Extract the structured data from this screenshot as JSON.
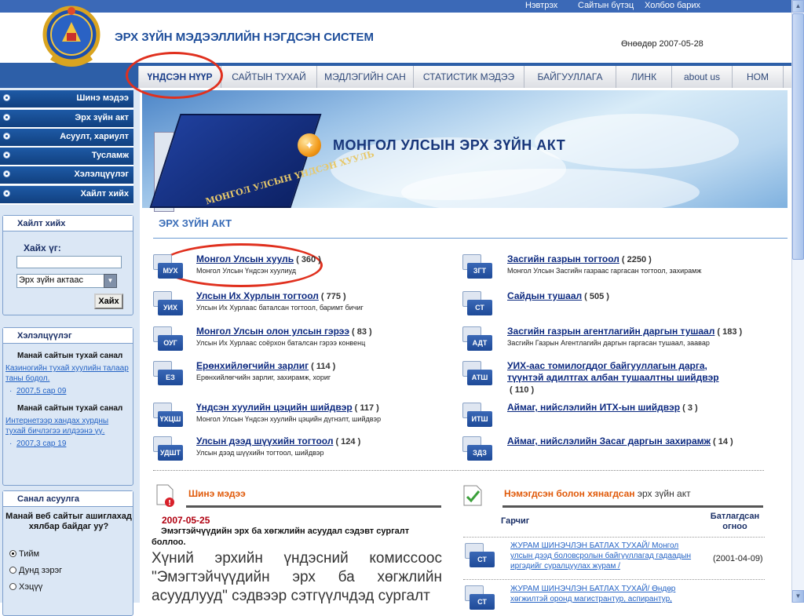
{
  "topbar": {
    "links": [
      "Нэвтрэх",
      "Сайтын бүтэц",
      "Холбоо барих"
    ]
  },
  "header": {
    "title": "ЭРХ ЗҮЙН МЭДЭЭЛЛИЙН НЭГДСЭН СИСТЕМ",
    "date_label": "Өнөөдөр",
    "date_value": "2007-05-28"
  },
  "nav": {
    "items": [
      "ҮНДСЭН НҮҮР",
      "САЙТЫН ТУХАЙ",
      "МЭДЛЭГИЙН САН",
      "СТАТИСТИК МЭДЭЭ",
      "БАЙГУУЛЛАГА",
      "ЛИНК",
      "about us",
      "НОМ"
    ],
    "active": "ҮНДСЭН НҮҮР"
  },
  "sidebar": {
    "menu": [
      "Шинэ мэдээ",
      "Эрх зүйн акт",
      "Асуулт, хариулт",
      "Тусламж",
      "Хэлэлцүүлэг",
      "Хайлт хийх"
    ],
    "search": {
      "title": "Хайлт хийх",
      "label": "Хайх үг:",
      "input_value": "",
      "select_value": "Эрх зүйн актаас",
      "button": "Хайх"
    },
    "discussion": {
      "title": "Хэлэлцүүлэг",
      "entries": [
        {
          "title": "Манай сайтын тухай санал",
          "link": "Казиногийн тухай хуулийн талаар таны бодол.",
          "date": "2007,5 сар 09"
        },
        {
          "title": "Манай сайтын тухай санал",
          "link": "Интернетээр хандах хурдны тухай бичлэгээ илдээнэ үү.",
          "date": "2007,3 сар 19"
        }
      ]
    },
    "poll": {
      "title": "Санал асуулга",
      "question": "Манай веб сайтыг ашиглахад хялбар байдаг уу?",
      "options": [
        "Тийм",
        "Дунд зэрэг",
        "Хэцүү"
      ],
      "selected": "Тийм"
    }
  },
  "banner": {
    "title": "МОНГОЛ УЛСЫН ЭРХ ЗҮЙН АКТ",
    "book_text": "МОНГОЛ УЛСЫН ҮНДСЭН ХУУЛЬ"
  },
  "acts": {
    "section_title": "ЭРХ ЗҮЙН АКТ",
    "left": [
      {
        "code": "МУХ",
        "title": "Монгол Улсын хууль",
        "count": "( 360 )",
        "desc": "Монгол Улсын Үндсэн хуулиуд"
      },
      {
        "code": "УИХ",
        "title": "Улсын Их Хурлын тогтоол",
        "count": "( 775 )",
        "desc": "Улсын Их Хурлаас баталсан тогтоол, баримт бичиг"
      },
      {
        "code": "ОУГ",
        "title": "Монгол Улсын олон улсын гэрээ",
        "count": "( 83 )",
        "desc": "Улсын Их Хурлаас соёрхон баталсан гэрээ конвенц"
      },
      {
        "code": "ЕЗ",
        "title": "Ерөнхийлөгчийн зарлиг",
        "count": "( 114 )",
        "desc": "Ерөнхийлөгчийн зарлиг, захирамж, хориг"
      },
      {
        "code": "ҮХЦШ",
        "title": "Үндсэн хуулийн цэцийн шийдвэр",
        "count": "( 117 )",
        "desc": "Монгол Улсын Үндсэн хуулийн цэцийн дүгнэлт, шийдвэр"
      },
      {
        "code": "УДШТ",
        "title": "Улсын дээд шүүхийн тогтоол",
        "count": "( 124 )",
        "desc": "Улсын дээд шүүхийн тогтоол, шийдвэр"
      }
    ],
    "right": [
      {
        "code": "ЗГТ",
        "title": "Засгийн газрын тогтоол",
        "count": "( 2250 )",
        "desc": "Монгол Улсын Засгийн газраас гаргасан тогтоол, захирамж"
      },
      {
        "code": "СТ",
        "title": "Сайдын тушаал",
        "count": "( 505 )",
        "desc": ""
      },
      {
        "code": "АДТ",
        "title": "Засгийн газрын агентлагийн даргын тушаал",
        "count": "( 183 )",
        "desc": "Засгийн Газрын Агентлагийн даргын гаргасан тушаал, заавар"
      },
      {
        "code": "АТШ",
        "title": "УИХ-аас томилогддог байгууллагын дарга, түүнтэй адилтгах албан тушаалтны шийдвэр",
        "count": "( 110 )",
        "desc": ""
      },
      {
        "code": "ИТШ",
        "title": "Аймаг, нийслэлийн ИТХ-ын шийдвэр",
        "count": "( 3 )",
        "desc": ""
      },
      {
        "code": "ЗДЗ",
        "title": "Аймаг, нийслэлийн Засаг даргын захирамж",
        "count": "( 14 )",
        "desc": ""
      }
    ]
  },
  "news": {
    "title": "Шинэ мэдээ",
    "date": "2007-05-25",
    "headline": "Эмэгтэйчүүдийн эрх ба хөгжлийн асуудал сэдэвт сургалт боллоо.",
    "body": "Хүний эрхийн үндэсний комиссоос \"Эмэгтэйчүүдийн эрх ба хөгжлийн асуудлууд\" сэдвээр сэтгүүлчдэд сургалт"
  },
  "updates": {
    "title_orange": "Нэмэгдсэн болон хянагдсан",
    "title_plain": "эрх зүйн акт",
    "col_title": "Гарчиг",
    "col_date": "Батлагдсан огноо",
    "rows": [
      {
        "code": "СТ",
        "text": "ЖУРАМ ШИНЭЧЛЭН БАТЛАХ ТУХАЙ/ Монгол улсын дээд боловсролын байгууллагад гадаадын иргэдийг суралцуулах журам /",
        "date": "(2001-04-09)"
      },
      {
        "code": "СТ",
        "text": "ЖУРАМ ШИНЭЧЛЭН БАТЛАХ ТУХАЙ/ Өндөр хөгжилтэй оронд магистрантур, аспирантур,",
        "date": ""
      }
    ]
  },
  "colors": {
    "nav_blue": "#2d5fa8",
    "accent_orange": "#e05a0a",
    "annotation_red": "#e0301e"
  }
}
